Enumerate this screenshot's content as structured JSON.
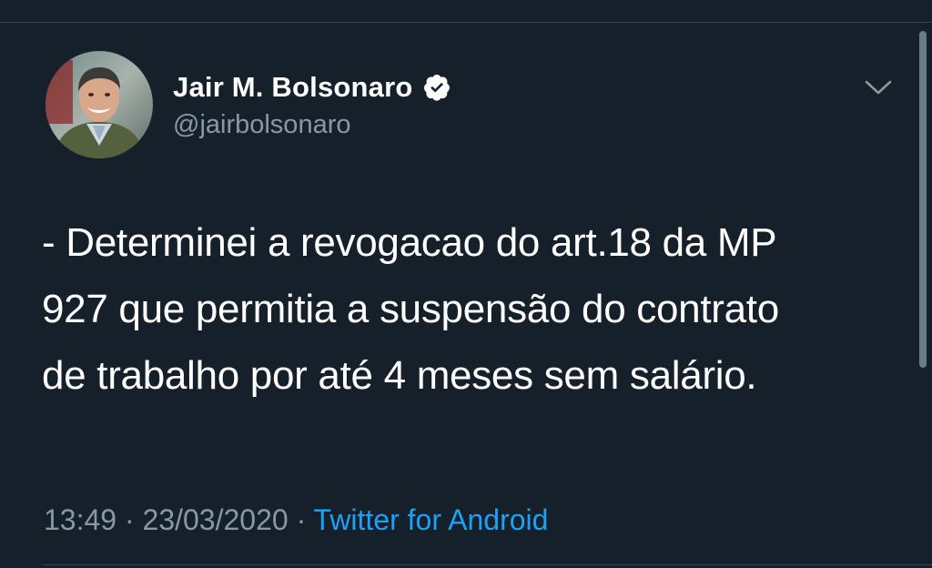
{
  "tweet": {
    "display_name": "Jair M. Bolsonaro",
    "username": "@jairbolsonaro",
    "verified": true,
    "text_lines": [
      "- Determinei a revogacao do art.18 da MP",
      "927 que permitia a suspensão do contrato",
      "de trabalho por até 4 meses sem salário."
    ],
    "time": "13:49",
    "separator": "·",
    "date": "23/03/2020",
    "source": "Twitter for Android"
  },
  "icons": {
    "verified": "verified-badge-icon",
    "menu": "chevron-down-icon"
  },
  "colors": {
    "background": "#15202b",
    "text": "#ffffff",
    "secondary_text": "#8899a6",
    "link": "#1da1f2",
    "divider": "#38444d"
  }
}
